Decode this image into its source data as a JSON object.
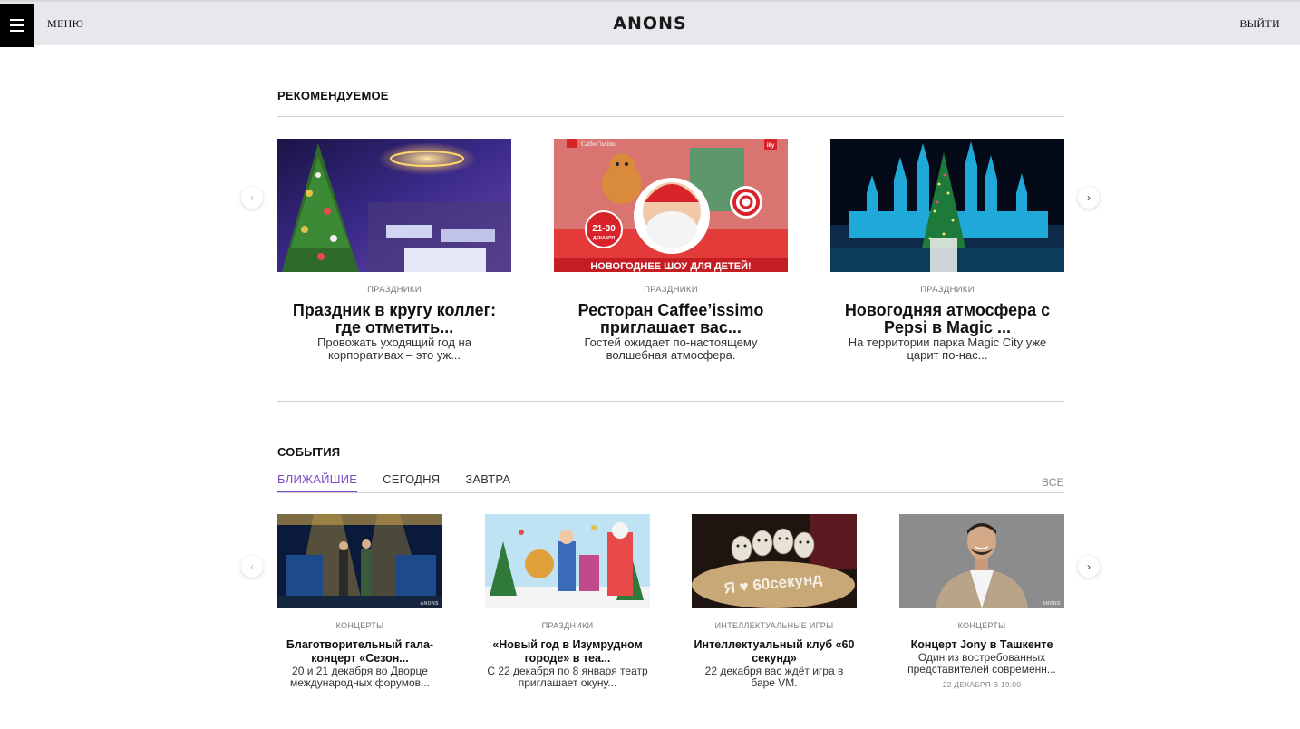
{
  "header": {
    "menu_label": "МЕНЮ",
    "logo": "ANONS",
    "logout_label": "ВЫЙТИ"
  },
  "featured": {
    "title": "РЕКОМЕНДУЕМОЕ",
    "cards": [
      {
        "category": "ПРАЗДНИКИ",
        "title": "Праздник в кругу коллег: где отметить...",
        "description": "Провожать уходящий год на корпоративах – это уж..."
      },
      {
        "category": "ПРАЗДНИКИ",
        "title": "Ресторан Caffee’issimo приглашает вас...",
        "description": "Гостей ожидает по-настоящему волшебная атмосфера.",
        "image_text": {
          "brand": "Caffee’issimo",
          "dates": "21-30",
          "month": "ДЕКАБРЯ",
          "banner": "НОВОГОДНЕЕ ШОУ ДЛЯ ДЕТЕЙ!",
          "corner_logo": "illy"
        }
      },
      {
        "category": "ПРАЗДНИКИ",
        "title": "Новогодняя атмосфера с Pepsi в Magic ...",
        "description": "На территории парка Magic City уже царит по-нас..."
      }
    ]
  },
  "events": {
    "title": "СОБЫТИЯ",
    "tabs": [
      {
        "label": "БЛИЖАЙШИЕ",
        "active": true
      },
      {
        "label": "СЕГОДНЯ",
        "active": false
      },
      {
        "label": "ЗАВТРА",
        "active": false
      }
    ],
    "all_label": "ВСЕ",
    "cards": [
      {
        "category": "КОНЦЕРТЫ",
        "title": "Благотворительный гала-концерт «Сезон...",
        "description": "20 и 21 декабря во Дворце международных форумов..."
      },
      {
        "category": "ПРАЗДНИКИ",
        "title": "«Новый год в Изумрудном городе» в теа...",
        "description": "С 22 декабря по 8 января театр приглашает окуну..."
      },
      {
        "category": "ИНТЕЛЛЕКТУАЛЬНЫЕ ИГРЫ",
        "title": "Интеллектуальный клуб «60 секунд»",
        "description": "22 декабря вас ждёт игра в баре VM.",
        "image_text": "Я ♥ 60секунд"
      },
      {
        "category": "КОНЦЕРТЫ",
        "title": "Концерт Jony в Ташкенте",
        "description": "Один из востребованных представителей современн...",
        "date": "22 ДЕКАБРЯ В 19:00"
      }
    ]
  },
  "watermark": "ANONS",
  "colors": {
    "header_bg": "#e9e7ec",
    "accent": "#7b4bc9",
    "banner_red": "#d8232a"
  }
}
